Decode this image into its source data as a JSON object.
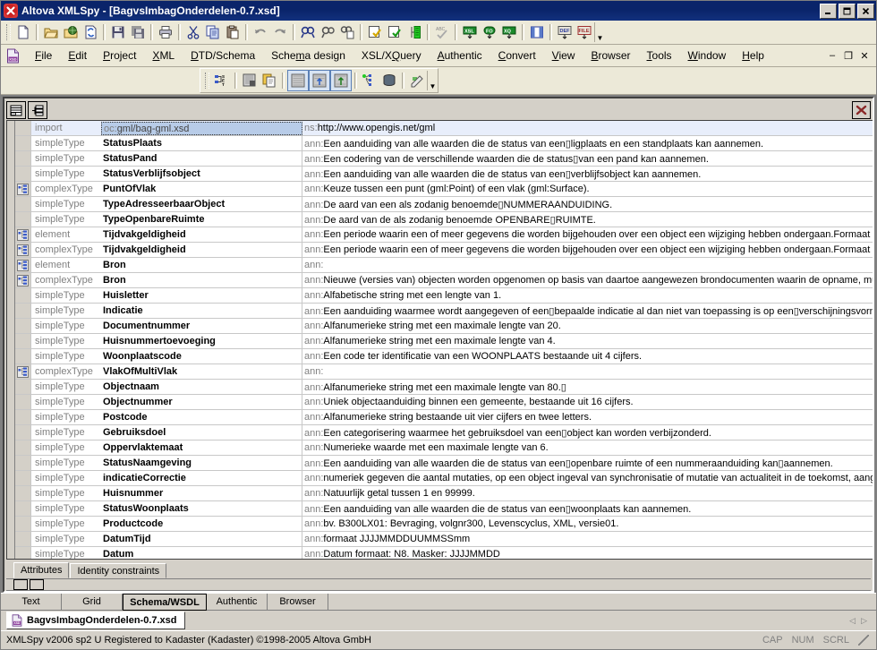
{
  "window": {
    "title": "Altova XMLSpy - [BagvsImbagOnderdelen-0.7.xsd]",
    "app_icon": "altova-x-icon",
    "minimize": "–",
    "maximize": "□",
    "close": "✕"
  },
  "toolbar": {
    "items": [
      {
        "name": "new-file-icon",
        "label": "New"
      },
      {
        "name": "open-file-icon",
        "label": "Open"
      },
      {
        "name": "open-url-icon",
        "label": "Open URL"
      },
      {
        "name": "reload-icon",
        "label": "Reload"
      },
      {
        "name": "save-icon",
        "label": "Save"
      },
      {
        "name": "save-all-icon",
        "label": "Save All"
      },
      {
        "name": "print-icon",
        "label": "Print"
      },
      {
        "name": "cut-icon",
        "label": "Cut"
      },
      {
        "name": "copy-icon",
        "label": "Copy"
      },
      {
        "name": "paste-icon",
        "label": "Paste"
      },
      {
        "name": "undo-icon",
        "label": "Undo"
      },
      {
        "name": "redo-icon",
        "label": "Redo"
      },
      {
        "name": "find-icon",
        "label": "Find"
      },
      {
        "name": "find-next-icon",
        "label": "Find Next"
      },
      {
        "name": "find-in-files-icon",
        "label": "Find in Files"
      },
      {
        "name": "check-wellformed-icon",
        "label": "Check well-formedness"
      },
      {
        "name": "validate-icon",
        "label": "Validate"
      },
      {
        "name": "xml-grid-icon",
        "label": "XML to Grid"
      },
      {
        "name": "spellcheck-icon",
        "label": "Spelling"
      },
      {
        "name": "xsl-transform-icon",
        "label": "XSL Transformation"
      },
      {
        "name": "xsl-fo-icon",
        "label": "XSL:FO Transformation"
      },
      {
        "name": "xquery-icon",
        "label": "XQuery Execution"
      },
      {
        "name": "split-view-icon",
        "label": "Split View"
      },
      {
        "name": "generate-dtd-icon",
        "label": "Generate DTD/Schema"
      },
      {
        "name": "generate-file-icon",
        "label": "Generate Sample File"
      }
    ],
    "overflow_chevron": "chevron-down-icon"
  },
  "menubar": {
    "app_icon": "xsd-document-icon",
    "items": [
      {
        "label": "File",
        "accel": "F"
      },
      {
        "label": "Edit",
        "accel": "E"
      },
      {
        "label": "Project",
        "accel": "P"
      },
      {
        "label": "XML",
        "accel": "X"
      },
      {
        "label": "DTD/Schema",
        "accel": "D"
      },
      {
        "label": "Schema design",
        "accel": "m"
      },
      {
        "label": "XSL/XQuery",
        "accel": "Q"
      },
      {
        "label": "Authentic",
        "accel": "A"
      },
      {
        "label": "Convert",
        "accel": "C"
      },
      {
        "label": "View",
        "accel": "V"
      },
      {
        "label": "Browser",
        "accel": "B"
      },
      {
        "label": "Tools",
        "accel": "T"
      },
      {
        "label": "Window",
        "accel": "W"
      },
      {
        "label": "Help",
        "accel": "H"
      }
    ],
    "mdi_controls": [
      "–",
      "❐",
      "✕"
    ]
  },
  "schema_toolbar": {
    "items": [
      {
        "name": "schema-settings-icon",
        "label": "Schema settings",
        "pressed": false
      },
      {
        "name": "display-all-globals-icon",
        "label": "Display all globals",
        "pressed": false
      },
      {
        "name": "copy-globals-icon",
        "label": "Copy as XML-Schema",
        "pressed": false
      },
      {
        "name": "view-model-icon",
        "label": "Display diagram",
        "pressed": true
      },
      {
        "name": "append-model-icon",
        "label": "Append",
        "pressed": true
      },
      {
        "name": "insert-model-icon",
        "label": "Insert",
        "pressed": true
      },
      {
        "name": "identity-constraint-icon",
        "label": "Identity constraints",
        "pressed": false
      },
      {
        "name": "database-icon",
        "label": "Generate documentation",
        "pressed": false
      },
      {
        "name": "annotate-icon",
        "label": "Annotations",
        "pressed": false
      }
    ],
    "overflow_chevron": "chevron-down-icon"
  },
  "document_toolbar": {
    "buttons": [
      {
        "name": "show-globals-list-icon",
        "label": "Display all globals"
      },
      {
        "name": "show-structure-icon",
        "label": "Display structure"
      }
    ],
    "close_label": "✕"
  },
  "grid": {
    "columns": [
      "kind",
      "name",
      "annotation"
    ],
    "rows": [
      {
        "icon": false,
        "kind": "import",
        "name": "oc:gml/bag-gml.xsd",
        "ann_prefix": "ns:",
        "ann": "http://www.opengis.net/gml",
        "selected": true
      },
      {
        "icon": false,
        "kind": "simpleType",
        "name": "StatusPlaats",
        "ann_prefix": "ann:",
        "ann": "Een aanduiding van alle waarden die de status van een▯ligplaats en een standplaats kan aannemen.",
        "selected": false
      },
      {
        "icon": false,
        "kind": "simpleType",
        "name": "StatusPand",
        "ann_prefix": "ann:",
        "ann": "Een codering van de verschillende waarden die de status▯van een pand kan aannemen.",
        "selected": false
      },
      {
        "icon": false,
        "kind": "simpleType",
        "name": "StatusVerblijfsobject",
        "ann_prefix": "ann:",
        "ann": "Een aanduiding van alle waarden die de status van een▯verblijfsobject kan aannemen.",
        "selected": false
      },
      {
        "icon": true,
        "kind": "complexType",
        "name": "PuntOfVlak",
        "ann_prefix": "ann:",
        "ann": "Keuze tussen een punt (gml:Point) of een vlak (gml:Surface).",
        "selected": false
      },
      {
        "icon": false,
        "kind": "simpleType",
        "name": "TypeAdresseerbaarObject",
        "ann_prefix": "ann:",
        "ann": "De aard van een als zodanig benoemde▯NUMMERAANDUIDING.",
        "selected": false
      },
      {
        "icon": false,
        "kind": "simpleType",
        "name": "TypeOpenbareRuimte",
        "ann_prefix": "ann:",
        "ann": "De aard van de als zodanig benoemde OPENBARE▯RUIMTE.",
        "selected": false
      },
      {
        "icon": true,
        "kind": "element",
        "name": "Tijdvakgeldigheid",
        "ann_prefix": "ann:",
        "ann": "Een periode waarin een of meer gegevens die worden bijgehouden over een object een wijziging hebben ondergaan.Formaat is D",
        "selected": false
      },
      {
        "icon": true,
        "kind": "complexType",
        "name": "Tijdvakgeldigheid",
        "ann_prefix": "ann:",
        "ann": "Een periode waarin een of meer gegevens die worden bijgehouden over een object een wijziging hebben ondergaan.Formaat is D",
        "selected": false
      },
      {
        "icon": true,
        "kind": "element",
        "name": "Bron",
        "ann_prefix": "ann:",
        "ann": "",
        "selected": false
      },
      {
        "icon": true,
        "kind": "complexType",
        "name": "Bron",
        "ann_prefix": "ann:",
        "ann": "Nieuwe (versies van) objecten worden opgenomen op basis van daartoe aangewezen brondocumenten waarin de opname, muta",
        "selected": false
      },
      {
        "icon": false,
        "kind": "simpleType",
        "name": "Huisletter",
        "ann_prefix": "ann:",
        "ann": "Alfabetische string met een lengte van 1.",
        "selected": false
      },
      {
        "icon": false,
        "kind": "simpleType",
        "name": "Indicatie",
        "ann_prefix": "ann:",
        "ann": "Een aanduiding waarmee wordt aangegeven of een▯bepaalde indicatie al dan niet van toepassing is op een▯verschijningsvorm v",
        "selected": false
      },
      {
        "icon": false,
        "kind": "simpleType",
        "name": "Documentnummer",
        "ann_prefix": "ann:",
        "ann": "Alfanumerieke string met een maximale lengte van 20.",
        "selected": false
      },
      {
        "icon": false,
        "kind": "simpleType",
        "name": "Huisnummertoevoeging",
        "ann_prefix": "ann:",
        "ann": "Alfanumerieke string met een maximale lengte van 4.",
        "selected": false
      },
      {
        "icon": false,
        "kind": "simpleType",
        "name": "Woonplaatscode",
        "ann_prefix": "ann:",
        "ann": "Een code ter identificatie van een WOONPLAATS bestaande uit 4 cijfers.",
        "selected": false
      },
      {
        "icon": true,
        "kind": "complexType",
        "name": "VlakOfMultiVlak",
        "ann_prefix": "ann:",
        "ann": "",
        "selected": false
      },
      {
        "icon": false,
        "kind": "simpleType",
        "name": "Objectnaam",
        "ann_prefix": "ann:",
        "ann": "Alfanumerieke string met een maximale lengte van 80.▯",
        "selected": false
      },
      {
        "icon": false,
        "kind": "simpleType",
        "name": "Objectnummer",
        "ann_prefix": "ann:",
        "ann": "Uniek objectaanduiding binnen een gemeente, bestaande uit 16 cijfers.",
        "selected": false
      },
      {
        "icon": false,
        "kind": "simpleType",
        "name": "Postcode",
        "ann_prefix": "ann:",
        "ann": "Alfanumerieke string bestaande uit vier cijfers en twee letters.",
        "selected": false
      },
      {
        "icon": false,
        "kind": "simpleType",
        "name": "Gebruiksdoel",
        "ann_prefix": "ann:",
        "ann": "Een categorisering waarmee het gebruiksdoel van een▯object kan worden verbijzonderd.",
        "selected": false
      },
      {
        "icon": false,
        "kind": "simpleType",
        "name": "Oppervlaktemaat",
        "ann_prefix": "ann:",
        "ann": "Numerieke waarde met een maximale lengte van 6.",
        "selected": false
      },
      {
        "icon": false,
        "kind": "simpleType",
        "name": "StatusNaamgeving",
        "ann_prefix": "ann:",
        "ann": "Een aanduiding van alle waarden die de status van een▯openbare ruimte of een nummeraanduiding kan▯aannemen.",
        "selected": false
      },
      {
        "icon": false,
        "kind": "simpleType",
        "name": "indicatieCorrectie",
        "ann_prefix": "ann:",
        "ann": "numeriek gegeven die aantal mutaties, op een object ingeval van synchronisatie of mutatie van actualiteit in de toekomst, aangeeft.",
        "selected": false
      },
      {
        "icon": false,
        "kind": "simpleType",
        "name": "Huisnummer",
        "ann_prefix": "ann:",
        "ann": "Natuurlijk getal tussen 1 en 99999.",
        "selected": false
      },
      {
        "icon": false,
        "kind": "simpleType",
        "name": "StatusWoonplaats",
        "ann_prefix": "ann:",
        "ann": "Een aanduiding van alle waarden die de status van een▯woonplaats kan aannemen.",
        "selected": false
      },
      {
        "icon": false,
        "kind": "simpleType",
        "name": "Productcode",
        "ann_prefix": "ann:",
        "ann": "bv. B300LX01: Bevraging, volgnr300, Levenscyclus, XML, versie01.",
        "selected": false
      },
      {
        "icon": false,
        "kind": "simpleType",
        "name": "DatumTijd",
        "ann_prefix": "ann:",
        "ann": "formaat JJJJMMDDUUMMSSmm",
        "selected": false
      },
      {
        "icon": false,
        "kind": "simpleType",
        "name": "Datum",
        "ann_prefix": "ann:",
        "ann": "Datum formaat: N8. Masker: JJJJMMDD",
        "selected": false
      }
    ]
  },
  "lower_tabs": {
    "items": [
      {
        "label": "Attributes",
        "active": true
      },
      {
        "label": "Identity constraints",
        "active": false
      }
    ]
  },
  "view_tabs": {
    "items": [
      {
        "label": "Text",
        "active": false
      },
      {
        "label": "Grid",
        "active": false
      },
      {
        "label": "Schema/WSDL",
        "active": true
      },
      {
        "label": "Authentic",
        "active": false
      },
      {
        "label": "Browser",
        "active": false
      }
    ]
  },
  "doc_tabs": {
    "items": [
      {
        "label": "BagvsImbagOnderdelen-0.7.xsd",
        "icon": "xsd-file-icon",
        "active": true
      }
    ],
    "prev_arrow": "◁",
    "next_arrow": "▷"
  },
  "statusbar": {
    "text": "XMLSpy v2006 sp2 U   Registered to Kadaster (Kadaster)   ©1998-2005 Altova GmbH",
    "indicators": [
      "CAP",
      "NUM",
      "SCRL"
    ]
  },
  "colors": {
    "titlebar": "#0a246a",
    "chrome": "#d4d0c8",
    "toolbar": "#ece9d8",
    "selection": "#b8cce8",
    "selected_row": "#e8eefb",
    "kind_text": "#808080",
    "grid_line": "#c8c8c8"
  }
}
